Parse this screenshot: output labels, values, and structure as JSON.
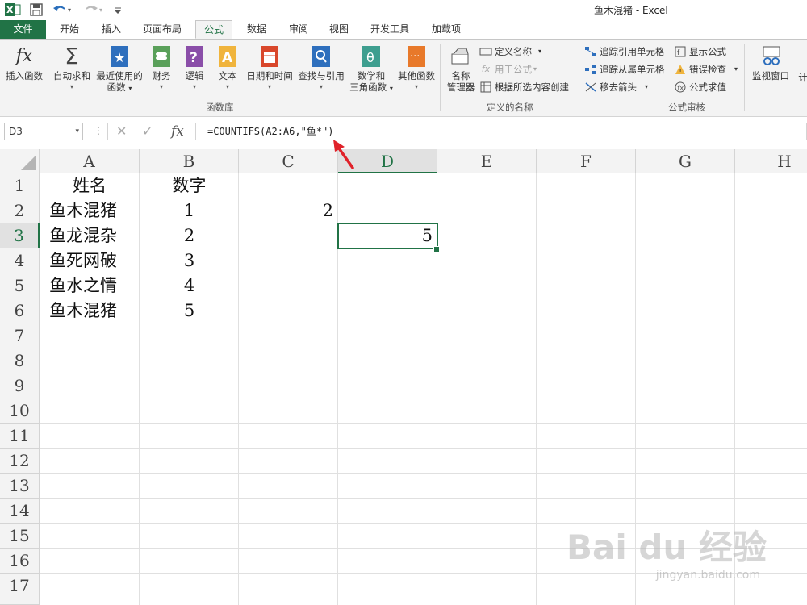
{
  "window": {
    "title": "鱼木混猪 - Excel"
  },
  "tabs": [
    {
      "label": "文件"
    },
    {
      "label": "开始"
    },
    {
      "label": "插入"
    },
    {
      "label": "页面布局"
    },
    {
      "label": "公式"
    },
    {
      "label": "数据"
    },
    {
      "label": "审阅"
    },
    {
      "label": "视图"
    },
    {
      "label": "开发工具"
    },
    {
      "label": "加载项"
    }
  ],
  "ribbon": {
    "function_library": {
      "group_label": "函数库",
      "insert_function": "插入函数",
      "autosum": "自动求和",
      "recent_line1": "最近使用的",
      "recent_line2": "函数",
      "financial": "财务",
      "logical": "逻辑",
      "text": "文本",
      "datetime": "日期和时间",
      "lookup": "查找与引用",
      "math_line1": "数学和",
      "math_line2": "三角函数",
      "more": "其他函数"
    },
    "defined_names": {
      "group_label": "定义的名称",
      "name_manager_line1": "名称",
      "name_manager_line2": "管理器",
      "define_name": "定义名称",
      "use_in_formula": "用于公式",
      "create_from_selection": "根据所选内容创建"
    },
    "auditing": {
      "group_label": "公式审核",
      "trace_precedents": "追踪引用单元格",
      "trace_dependents": "追踪从属单元格",
      "remove_arrows": "移去箭头",
      "show_formulas": "显示公式",
      "error_checking": "错误检查",
      "evaluate_formula": "公式求值",
      "watch_window": "监视窗口",
      "calc_partial": "计"
    }
  },
  "formula_bar": {
    "name_box": "D3",
    "formula": "=COUNTIFS(A2:A6,\"鱼*\")"
  },
  "sheet": {
    "columns": [
      "A",
      "B",
      "C",
      "D",
      "E",
      "F",
      "G",
      "H"
    ],
    "rows": [
      "1",
      "2",
      "3",
      "4",
      "5",
      "6",
      "7",
      "8",
      "9",
      "10",
      "11",
      "12",
      "13",
      "14",
      "15",
      "16",
      "17"
    ],
    "A": [
      "姓名",
      "鱼木混猪",
      "鱼龙混杂",
      "鱼死网破",
      "鱼水之情",
      "鱼木混猪"
    ],
    "B": [
      "数字",
      "1",
      "2",
      "3",
      "4",
      "5"
    ],
    "C2": "2",
    "D3": "5",
    "selected": "D3"
  },
  "colors": {
    "accent": "#217346",
    "arrow": "#e0222a"
  },
  "watermark": {
    "main": "Bai du 经验",
    "sub": "jingyan.baidu.com"
  }
}
